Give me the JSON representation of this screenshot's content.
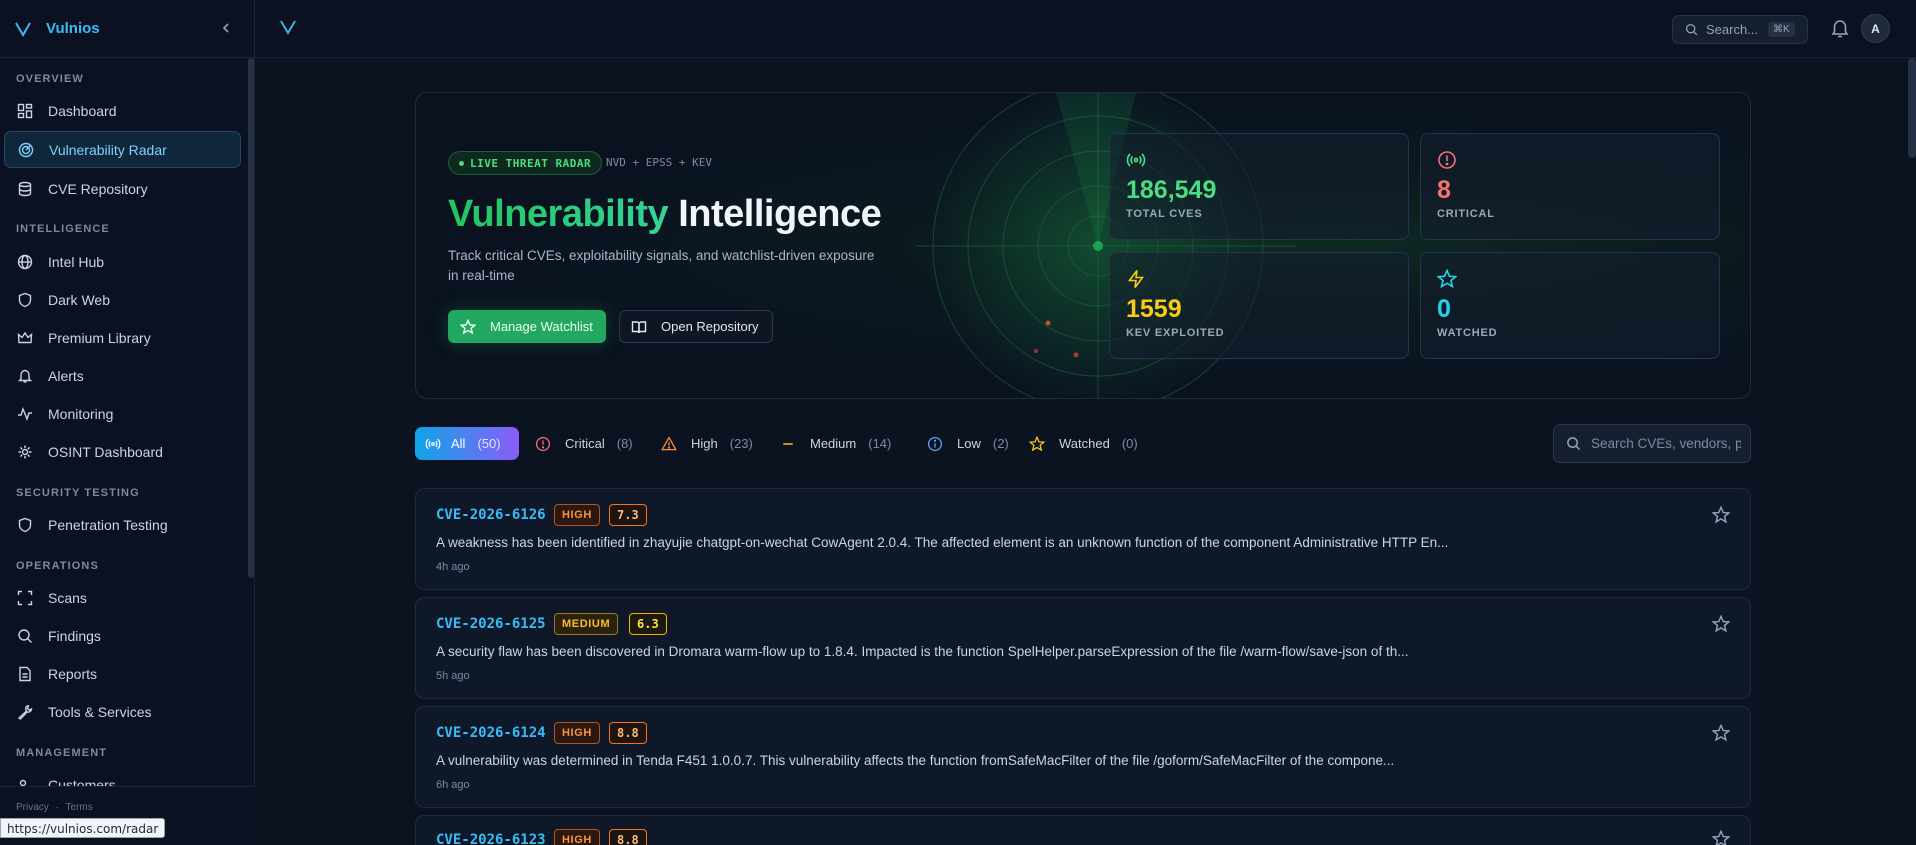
{
  "brand": {
    "name": "Vulnios"
  },
  "sidebar": {
    "sections": [
      {
        "label": "OVERVIEW"
      },
      {
        "label": "INTELLIGENCE"
      },
      {
        "label": "SECURITY TESTING"
      },
      {
        "label": "OPERATIONS"
      },
      {
        "label": "MANAGEMENT"
      }
    ],
    "items": [
      {
        "label": "Dashboard",
        "icon": "grid-icon"
      },
      {
        "label": "Vulnerability Radar",
        "icon": "radar-icon",
        "active": true
      },
      {
        "label": "CVE Repository",
        "icon": "database-icon"
      },
      {
        "label": "Intel Hub",
        "icon": "globe-icon"
      },
      {
        "label": "Dark Web",
        "icon": "shield-icon"
      },
      {
        "label": "Premium Library",
        "icon": "crown-icon"
      },
      {
        "label": "Alerts",
        "icon": "bell-icon"
      },
      {
        "label": "Monitoring",
        "icon": "activity-icon"
      },
      {
        "label": "OSINT Dashboard",
        "icon": "settings-icon"
      },
      {
        "label": "Penetration Testing",
        "icon": "shield-icon"
      },
      {
        "label": "Scans",
        "icon": "scan-icon"
      },
      {
        "label": "Findings",
        "icon": "search-icon"
      },
      {
        "label": "Reports",
        "icon": "file-icon"
      },
      {
        "label": "Tools & Services",
        "icon": "wrench-icon"
      },
      {
        "label": "Customers",
        "icon": "users-icon"
      }
    ],
    "footer": {
      "privacy": "Privacy",
      "separator": "·",
      "terms": "Terms"
    }
  },
  "statusbar": {
    "url": "https://vulnios.com/radar"
  },
  "topbar": {
    "search_label": "Search...",
    "shortcut": "⌘K",
    "avatar_initial": "A"
  },
  "hero": {
    "badge": "LIVE THREAT RADAR",
    "sources": "NVD + EPSS + KEV",
    "title_accent": "Vulnerability",
    "title_rest": "Intelligence",
    "subtitle": "Track critical CVEs, exploitability signals, and watchlist-driven exposure in real-time",
    "primary_button": "Manage Watchlist",
    "secondary_button": "Open Repository",
    "stats": [
      {
        "value": "186,549",
        "label": "TOTAL CVES",
        "color": "#4ade80",
        "icon": "broadcast-icon"
      },
      {
        "value": "8",
        "label": "CRITICAL",
        "color": "#f87171",
        "icon": "alert-circle-icon"
      },
      {
        "value": "1559",
        "label": "KEV EXPLOITED",
        "color": "#facc15",
        "icon": "bolt-icon"
      },
      {
        "value": "0",
        "label": "WATCHED",
        "color": "#22d3ee",
        "icon": "star-icon"
      }
    ]
  },
  "filters": {
    "tabs": [
      {
        "label": "All",
        "count": "(50)",
        "icon": "broadcast-icon",
        "active": true
      },
      {
        "label": "Critical",
        "count": "(8)",
        "icon": "alert-circle-icon"
      },
      {
        "label": "High",
        "count": "(23)",
        "icon": "triangle-alert-icon"
      },
      {
        "label": "Medium",
        "count": "(14)",
        "icon": "minus-icon"
      },
      {
        "label": "Low",
        "count": "(2)",
        "icon": "info-icon"
      },
      {
        "label": "Watched",
        "count": "(0)",
        "icon": "star-icon"
      }
    ],
    "search_placeholder": "Search CVEs, vendors, p"
  },
  "cves": [
    {
      "id": "CVE-2026-6126",
      "severity": "HIGH",
      "score": "7.3",
      "description": "A weakness has been identified in zhayujie chatgpt-on-wechat CowAgent 2.0.4. The affected element is an unknown function of the component Administrative HTTP En...",
      "age": "4h ago"
    },
    {
      "id": "CVE-2026-6125",
      "severity": "MEDIUM",
      "score": "6.3",
      "description": "A security flaw has been discovered in Dromara warm-flow up to 1.8.4. Impacted is the function SpelHelper.parseExpression of the file /warm-flow/save-json of th...",
      "age": "5h ago"
    },
    {
      "id": "CVE-2026-6124",
      "severity": "HIGH",
      "score": "8.8",
      "description": "A vulnerability was determined in Tenda F451 1.0.0.7. This vulnerability affects the function fromSafeMacFilter of the file /goform/SafeMacFilter of the compone...",
      "age": "6h ago"
    },
    {
      "id": "CVE-2026-6123",
      "severity": "HIGH",
      "score": "8.8",
      "description": "",
      "age": ""
    }
  ]
}
